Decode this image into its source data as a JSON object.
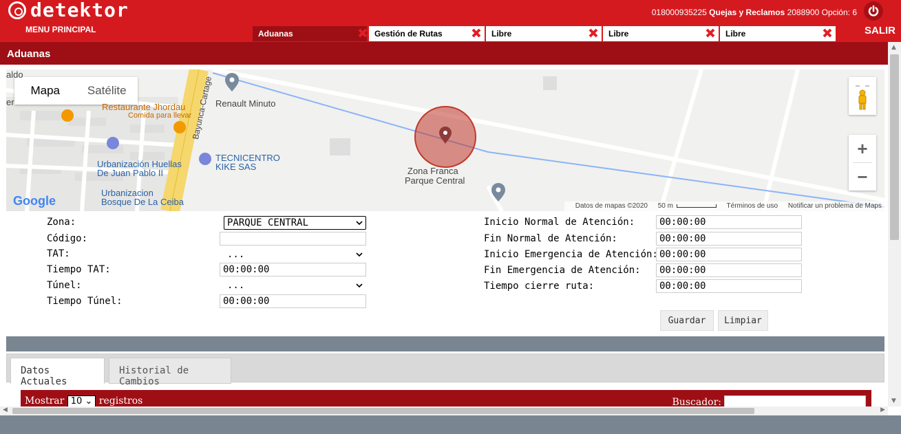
{
  "header": {
    "brand": "detektor",
    "menu_label": "MENU PRINCIPAL",
    "phone": "018000935225",
    "complaints_label": "Quejas y Reclamos",
    "complaints_phone": "2088900 Opción: 6",
    "exit_label": "SALIR",
    "tabs": [
      {
        "label": "Aduanas",
        "active": true
      },
      {
        "label": "Gestión de Rutas",
        "active": false
      },
      {
        "label": "Libre",
        "active": false
      },
      {
        "label": "Libre",
        "active": false
      },
      {
        "label": "Libre",
        "active": false
      }
    ]
  },
  "section": {
    "title": "Aduanas"
  },
  "map": {
    "type_map": "Mapa",
    "type_satellite": "Satélite",
    "labels": {
      "aldo": "aldo",
      "er": "er",
      "restaurant": "Restaurante Jhordau",
      "food": "Comida para llevar",
      "renault": "Renault Minuto",
      "road": "Bayunca-Cartage",
      "tecnicentro_1": "TECNICENTRO",
      "tecnicentro_2": "KIKE SAS",
      "urb1_1": "Urbanización Huellas",
      "urb1_2": "De Juan Pablo II",
      "urb2_1": "Urbanizacion",
      "urb2_2": "Bosque De La Ceiba",
      "zona_1": "Zona Franca",
      "zona_2": "Parque Central"
    },
    "google": "Google",
    "attribution": {
      "data": "Datos de mapas ©2020",
      "scale": "50 m",
      "terms": "Términos de uso",
      "report": "Notificar un problema de Maps"
    },
    "zoom_in": "+",
    "zoom_out": "−"
  },
  "form": {
    "left": {
      "zona_label": "Zona:",
      "zona_value": "PARQUE CENTRAL",
      "codigo_label": "Código:",
      "codigo_value": "",
      "tat_label": "TAT:",
      "tat_value": "...",
      "tiempo_tat_label": "Tiempo TAT:",
      "tiempo_tat_value": "00:00:00",
      "tunel_label": "Túnel:",
      "tunel_value": "...",
      "tiempo_tunel_label": "Tiempo Túnel:",
      "tiempo_tunel_value": "00:00:00"
    },
    "right": {
      "inicio_normal_label": "Inicio Normal de Atención:",
      "inicio_normal_value": "00:00:00",
      "fin_normal_label": "Fin Normal de Atención:",
      "fin_normal_value": "00:00:00",
      "inicio_emerg_label": "Inicio Emergencia de Atención:",
      "inicio_emerg_value": "00:00:00",
      "fin_emerg_label": "Fin Emergencia de Atención:",
      "fin_emerg_value": "00:00:00",
      "cierre_label": "Tiempo cierre ruta:",
      "cierre_value": "00:00:00"
    },
    "save_label": "Guardar",
    "clear_label": "Limpiar"
  },
  "lower_tabs": [
    {
      "label": "Datos Actuales",
      "active": true
    },
    {
      "label": "Historial de Cambios",
      "active": false
    }
  ],
  "table": {
    "show_label": "Mostrar",
    "show_value": "10",
    "records_label": "registros",
    "search_label": "Buscador:"
  },
  "colors": {
    "brand_red": "#d51a1f",
    "dark_red": "#9e0f15",
    "slate": "#7a8592",
    "marker_red": "#c0392b"
  }
}
